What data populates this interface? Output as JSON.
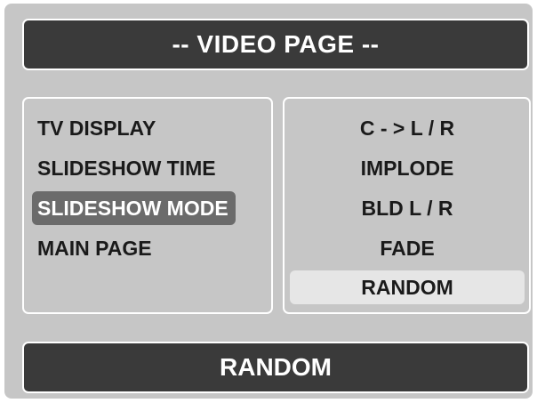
{
  "header": {
    "title": "-- VIDEO PAGE --"
  },
  "menu": {
    "items": [
      {
        "label": "TV DISPLAY",
        "selected": false
      },
      {
        "label": "SLIDESHOW TIME",
        "selected": false
      },
      {
        "label": "SLIDESHOW MODE",
        "selected": true
      },
      {
        "label": "MAIN PAGE",
        "selected": false
      }
    ]
  },
  "options": {
    "items": [
      {
        "label": "C - > L / R",
        "highlighted": false
      },
      {
        "label": "IMPLODE",
        "highlighted": false
      },
      {
        "label": "BLD L / R",
        "highlighted": false
      },
      {
        "label": "FADE",
        "highlighted": false
      },
      {
        "label": "RANDOM",
        "highlighted": true
      }
    ]
  },
  "status": {
    "value": "RANDOM"
  },
  "colors": {
    "background": "#c6c6c6",
    "bar": "#3a3a3a",
    "selected_menu": "#6b6b6b",
    "highlighted_option": "#e6e6e6"
  }
}
